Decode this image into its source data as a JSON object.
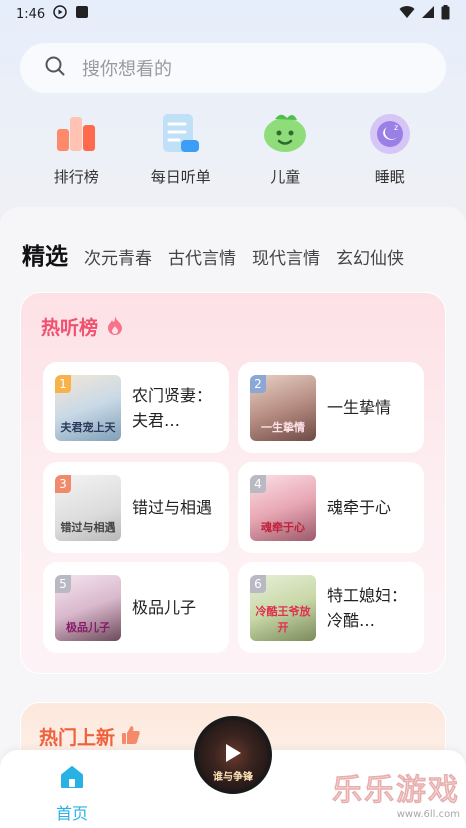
{
  "status_bar": {
    "time": "1:46"
  },
  "search": {
    "placeholder": "搜你想看的"
  },
  "quick_links": [
    {
      "label": "排行榜",
      "icon": "ranking-icon"
    },
    {
      "label": "每日听单",
      "icon": "daily-list-icon"
    },
    {
      "label": "儿童",
      "icon": "children-icon"
    },
    {
      "label": "睡眠",
      "icon": "sleep-icon"
    }
  ],
  "tabs": [
    "精选",
    "次元青春",
    "古代言情",
    "现代言情",
    "玄幻仙侠"
  ],
  "active_tab": "精选",
  "hot_list": {
    "title": "热听榜",
    "books": [
      {
        "rank": "1",
        "title": "农门贤妻：夫君…",
        "cover_text": "夫君宠上天",
        "rank_color": "#f7b24a"
      },
      {
        "rank": "2",
        "title": "一生挚情",
        "cover_text": "一生挚情",
        "rank_color": "#8aa7d6"
      },
      {
        "rank": "3",
        "title": "错过与相遇",
        "cover_text": "错过与相遇",
        "rank_color": "#f08a6a"
      },
      {
        "rank": "4",
        "title": "魂牵于心",
        "cover_text": "魂牵于心",
        "rank_color": "#b9b9c4"
      },
      {
        "rank": "5",
        "title": "极品儿子",
        "cover_text": "极品儿子",
        "rank_color": "#b9b9c4"
      },
      {
        "rank": "6",
        "title": "特工媳妇：冷酷…",
        "cover_text": "冷酷王爷放开",
        "rank_color": "#b9b9c4"
      }
    ]
  },
  "new_list": {
    "title": "热门上新"
  },
  "player": {
    "disc_text": "谁与争锋"
  },
  "bottom_nav": {
    "home_label": "首页"
  },
  "watermark": {
    "text": "乐乐游戏",
    "url": "www.6ll.com"
  },
  "colors": {
    "accent": "#28b2e4",
    "hot_title": "#f0516f",
    "new_title": "#f0613c"
  }
}
